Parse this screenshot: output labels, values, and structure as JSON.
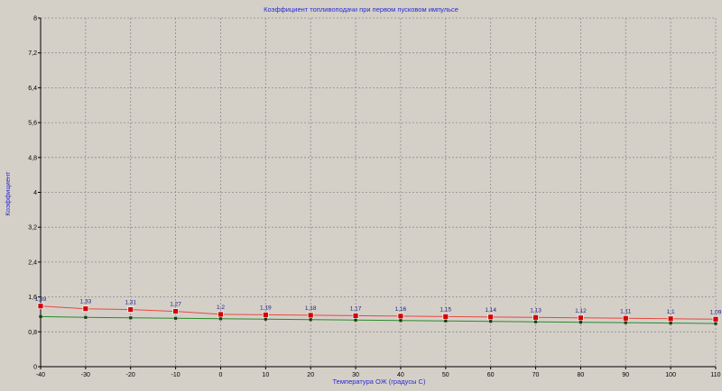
{
  "chart_data": {
    "type": "line",
    "title": "Коэффициент топливоподачи при первом пусковом импульсе",
    "xlabel": "Температура ОЖ (градусы С)",
    "ylabel": "Коэффициент",
    "x": [
      -40,
      -30,
      -20,
      -10,
      0,
      10,
      20,
      30,
      40,
      50,
      60,
      70,
      80,
      90,
      100,
      110
    ],
    "x_tick_labels": [
      "-40",
      "-30",
      "-20",
      "-10",
      "0",
      "10",
      "20",
      "30",
      "40",
      "50",
      "60",
      "70",
      "80",
      "90",
      "100",
      "110"
    ],
    "y_ticks": [
      0,
      0.8,
      1.6,
      2.4,
      3.2,
      4,
      4.8,
      5.6,
      6.4,
      7.2,
      8
    ],
    "y_tick_labels": [
      "0",
      "0,8",
      "1,6",
      "2,4",
      "3,2",
      "4",
      "4,8",
      "5,6",
      "6,4",
      "7,2",
      "8"
    ],
    "xlim": [
      -40,
      110
    ],
    "ylim": [
      0,
      8
    ],
    "grid": true,
    "series": [
      {
        "color": "#e8483f",
        "marker_color": "#d40000",
        "values": [
          1.39,
          1.33,
          1.31,
          1.27,
          1.2,
          1.19,
          1.18,
          1.17,
          1.16,
          1.15,
          1.14,
          1.13,
          1.12,
          1.11,
          1.1,
          1.09
        ],
        "data_labels": [
          "1,39",
          "1,33",
          "1,31",
          "1,27",
          "1,2",
          "1,19",
          "1,18",
          "1,17",
          "1,16",
          "1,15",
          "1,14",
          "1,13",
          "1,12",
          "1,11",
          "1,1",
          "1,09"
        ]
      },
      {
        "color": "#2a8a2a",
        "marker_color": "#1a3a1a",
        "values": [
          1.15,
          1.13,
          1.12,
          1.11,
          1.1,
          1.09,
          1.08,
          1.07,
          1.06,
          1.05,
          1.04,
          1.03,
          1.02,
          1.01,
          1.0,
          0.99
        ]
      }
    ],
    "colors": {
      "background": "#d4d0c8",
      "grid": "#8c8c8c",
      "axis": "#000000",
      "title": "#2a2ad4",
      "data_label": "#1c1c8c"
    }
  }
}
